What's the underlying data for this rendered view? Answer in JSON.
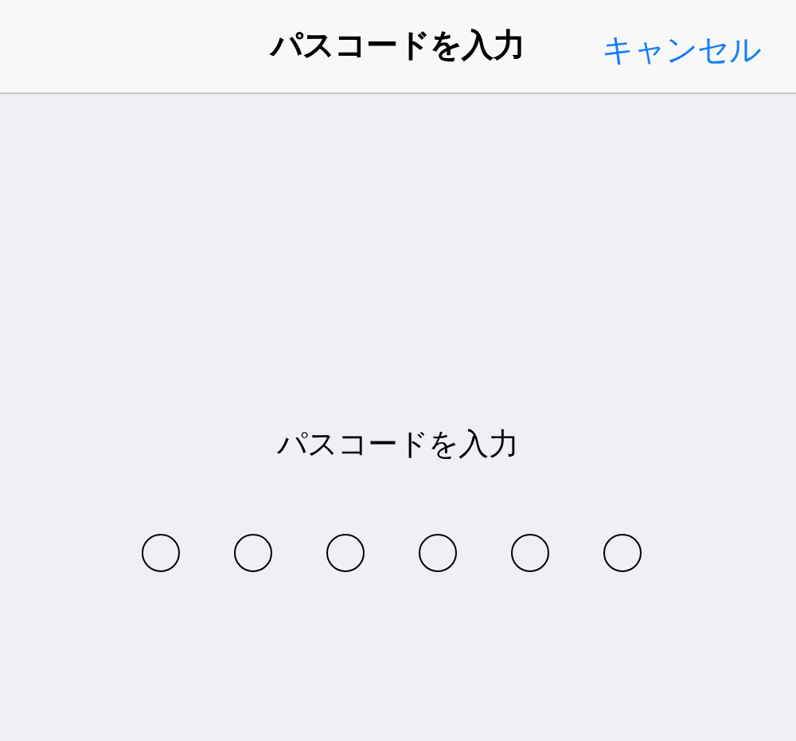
{
  "nav_bar": {
    "title": "パスコードを入力",
    "cancel": "キャンセル"
  },
  "prompt": "パスコードを入力",
  "dots": [
    {
      "filled": false
    },
    {
      "filled": false
    },
    {
      "filled": false
    },
    {
      "filled": false
    },
    {
      "filled": false
    },
    {
      "filled": false
    }
  ]
}
